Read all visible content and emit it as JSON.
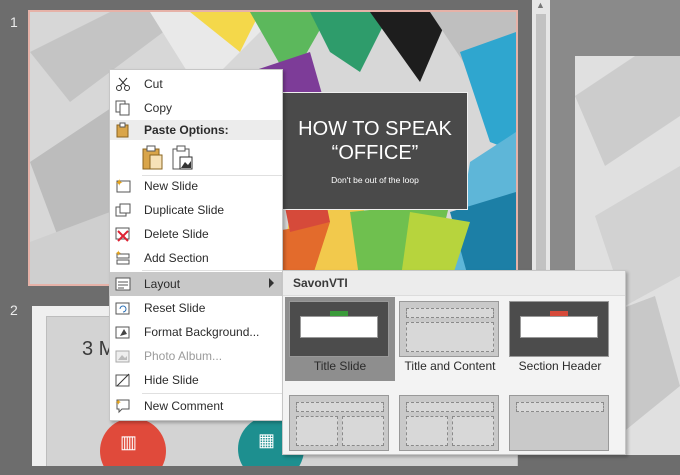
{
  "thumbnails": [
    {
      "number": "1",
      "title_line1": "HOW TO SPEAK",
      "title_line2": "“OFFICE”",
      "subtitle": "Don't be out of the loop"
    },
    {
      "number": "2",
      "title_partial": "3 M"
    }
  ],
  "context_menu": {
    "items": [
      {
        "label": "Cut",
        "icon": "scissors-icon",
        "enabled": true
      },
      {
        "label": "Copy",
        "icon": "copy-icon",
        "enabled": true
      },
      {
        "label": "Paste Options:",
        "icon": "clipboard-icon",
        "section": true
      },
      {
        "label": "New Slide",
        "icon": "new-slide-icon",
        "enabled": true
      },
      {
        "label": "Duplicate Slide",
        "icon": "duplicate-slide-icon",
        "enabled": true
      },
      {
        "label": "Delete Slide",
        "icon": "delete-slide-icon",
        "enabled": true
      },
      {
        "label": "Add Section",
        "icon": "add-section-icon",
        "enabled": true
      },
      {
        "label": "Layout",
        "icon": "layout-icon",
        "enabled": true,
        "highlighted": true,
        "has_submenu": true
      },
      {
        "label": "Reset Slide",
        "icon": "reset-slide-icon",
        "enabled": true
      },
      {
        "label": "Format Background...",
        "icon": "format-background-icon",
        "enabled": true
      },
      {
        "label": "Photo Album...",
        "icon": "photo-album-icon",
        "enabled": false
      },
      {
        "label": "Hide Slide",
        "icon": "hide-slide-icon",
        "enabled": true
      },
      {
        "label": "New Comment",
        "icon": "new-comment-icon",
        "enabled": true
      }
    ]
  },
  "layout_submenu": {
    "header": "SavonVTI",
    "layouts": [
      {
        "label": "Title Slide",
        "selected": true
      },
      {
        "label": "Title and Content",
        "selected": false
      },
      {
        "label": "Section Header",
        "selected": false
      }
    ]
  },
  "colors": {
    "accent_green": "#3a9b3a",
    "accent_red": "#d64a3a",
    "highlight": "#c8c8c8"
  }
}
